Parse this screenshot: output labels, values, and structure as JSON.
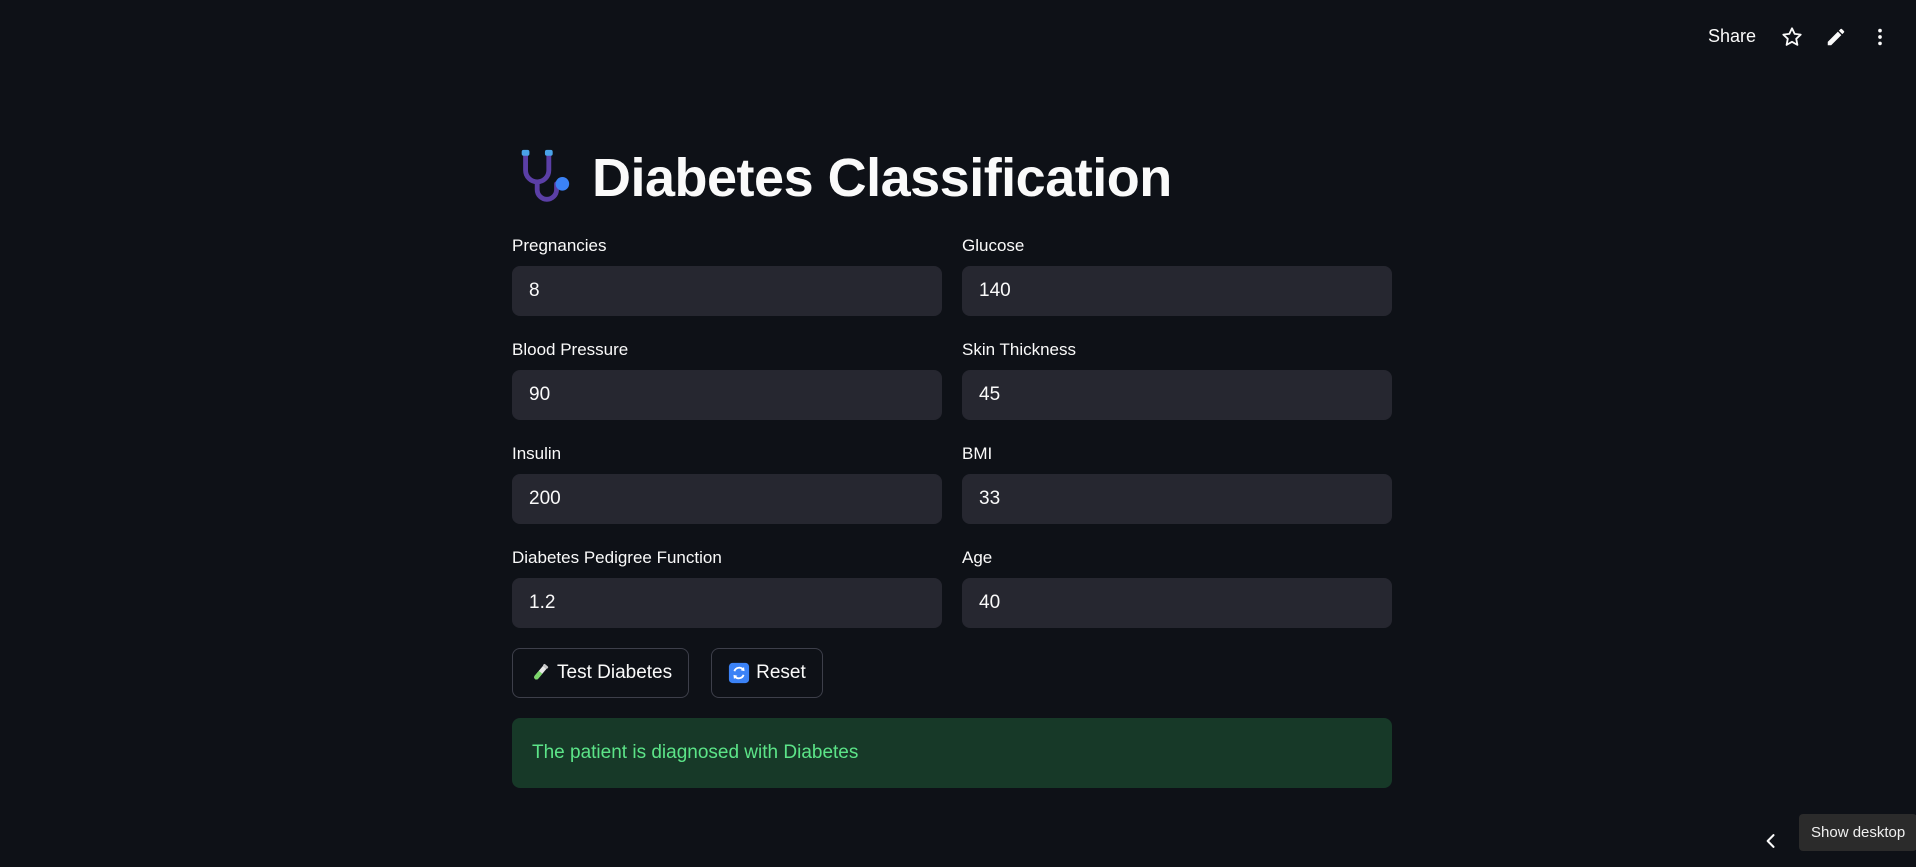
{
  "toolbar": {
    "share_label": "Share",
    "icons": [
      "star-icon",
      "pencil-icon",
      "more-vertical-icon"
    ]
  },
  "page": {
    "title": "Diabetes Classification",
    "title_icon": "stethoscope-icon"
  },
  "form": {
    "pregnancies": {
      "label": "Pregnancies",
      "value": "8"
    },
    "glucose": {
      "label": "Glucose",
      "value": "140"
    },
    "blood_pressure": {
      "label": "Blood Pressure",
      "value": "90"
    },
    "skin_thickness": {
      "label": "Skin Thickness",
      "value": "45"
    },
    "insulin": {
      "label": "Insulin",
      "value": "200"
    },
    "bmi": {
      "label": "BMI",
      "value": "33"
    },
    "dpf": {
      "label": "Diabetes Pedigree Function",
      "value": "1.2"
    },
    "age": {
      "label": "Age",
      "value": "40"
    }
  },
  "buttons": {
    "test_label": "Test Diabetes",
    "test_icon": "test-tube-icon",
    "reset_label": "Reset",
    "reset_icon": "refresh-icon"
  },
  "result": {
    "message": "The patient is diagnosed with Diabetes",
    "color": "#5ce488",
    "background": "#173928"
  },
  "system": {
    "tooltip": "Show desktop"
  },
  "colors": {
    "background": "#0e1117",
    "input_bg": "#262730",
    "text": "#fafafa"
  }
}
